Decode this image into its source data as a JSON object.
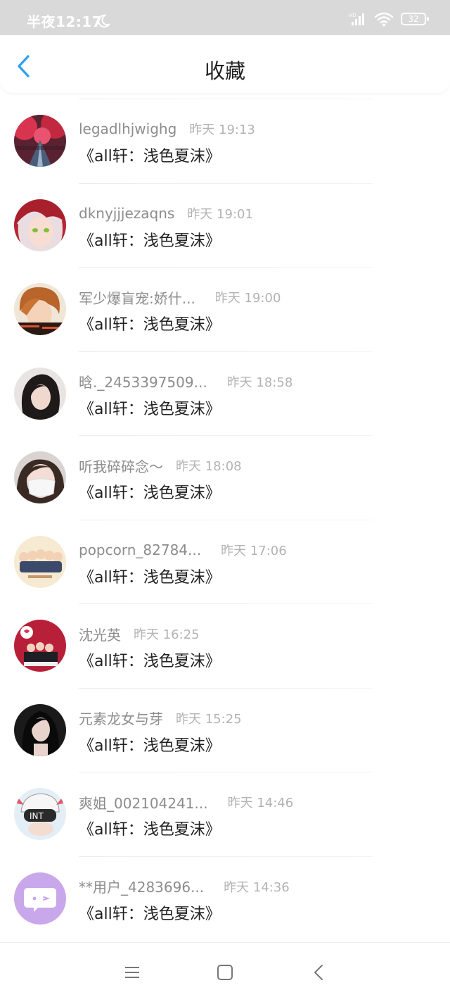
{
  "status_bar": {
    "time": "半夜12:17",
    "network": "HD",
    "battery": "32"
  },
  "header": {
    "title": "收藏"
  },
  "items": [
    {
      "name": "legadlhjwighg",
      "time": "昨天 19:13",
      "book": "《all轩：浅色夏沫》"
    },
    {
      "name": "dknyjjjezaqns",
      "time": "昨天 19:01",
      "book": "《all轩：浅色夏沫》"
    },
    {
      "name": "军少爆盲宠:娇什...",
      "time": "昨天 19:00",
      "book": "《all轩：浅色夏沫》"
    },
    {
      "name": "晗._2453397509...",
      "time": "昨天 18:58",
      "book": "《all轩：浅色夏沫》"
    },
    {
      "name": "听我碎碎念～",
      "time": "昨天 18:08",
      "book": "《all轩：浅色夏沫》"
    },
    {
      "name": "popcorn_82784...",
      "time": "昨天 17:06",
      "book": "《all轩：浅色夏沫》"
    },
    {
      "name": "沈光英",
      "time": "昨天 16:25",
      "book": "《all轩：浅色夏沫》"
    },
    {
      "name": "元素龙女与芽",
      "time": "昨天 15:25",
      "book": "《all轩：浅色夏沫》"
    },
    {
      "name": "爽姐_002104241...",
      "time": "昨天 14:46",
      "book": "《all轩：浅色夏沫》"
    },
    {
      "name": "**用户_4283696...",
      "time": "昨天 14:36",
      "book": "《all轩：浅色夏沫》"
    }
  ],
  "colors": {
    "accent": "#2c9ff0",
    "status_bar_bg": "#d9d9d9",
    "title_text": "#222222",
    "name_text": "#8c8c8c",
    "time_text": "#b3b3b3"
  },
  "icons": {
    "back": "chevron-left-icon",
    "moon": "moon-icon",
    "signal": "signal-icon",
    "wifi": "wifi-icon",
    "battery": "battery-icon",
    "nav_menu": "menu-icon",
    "nav_home": "home-square-icon",
    "nav_back": "back-triangle-icon"
  }
}
